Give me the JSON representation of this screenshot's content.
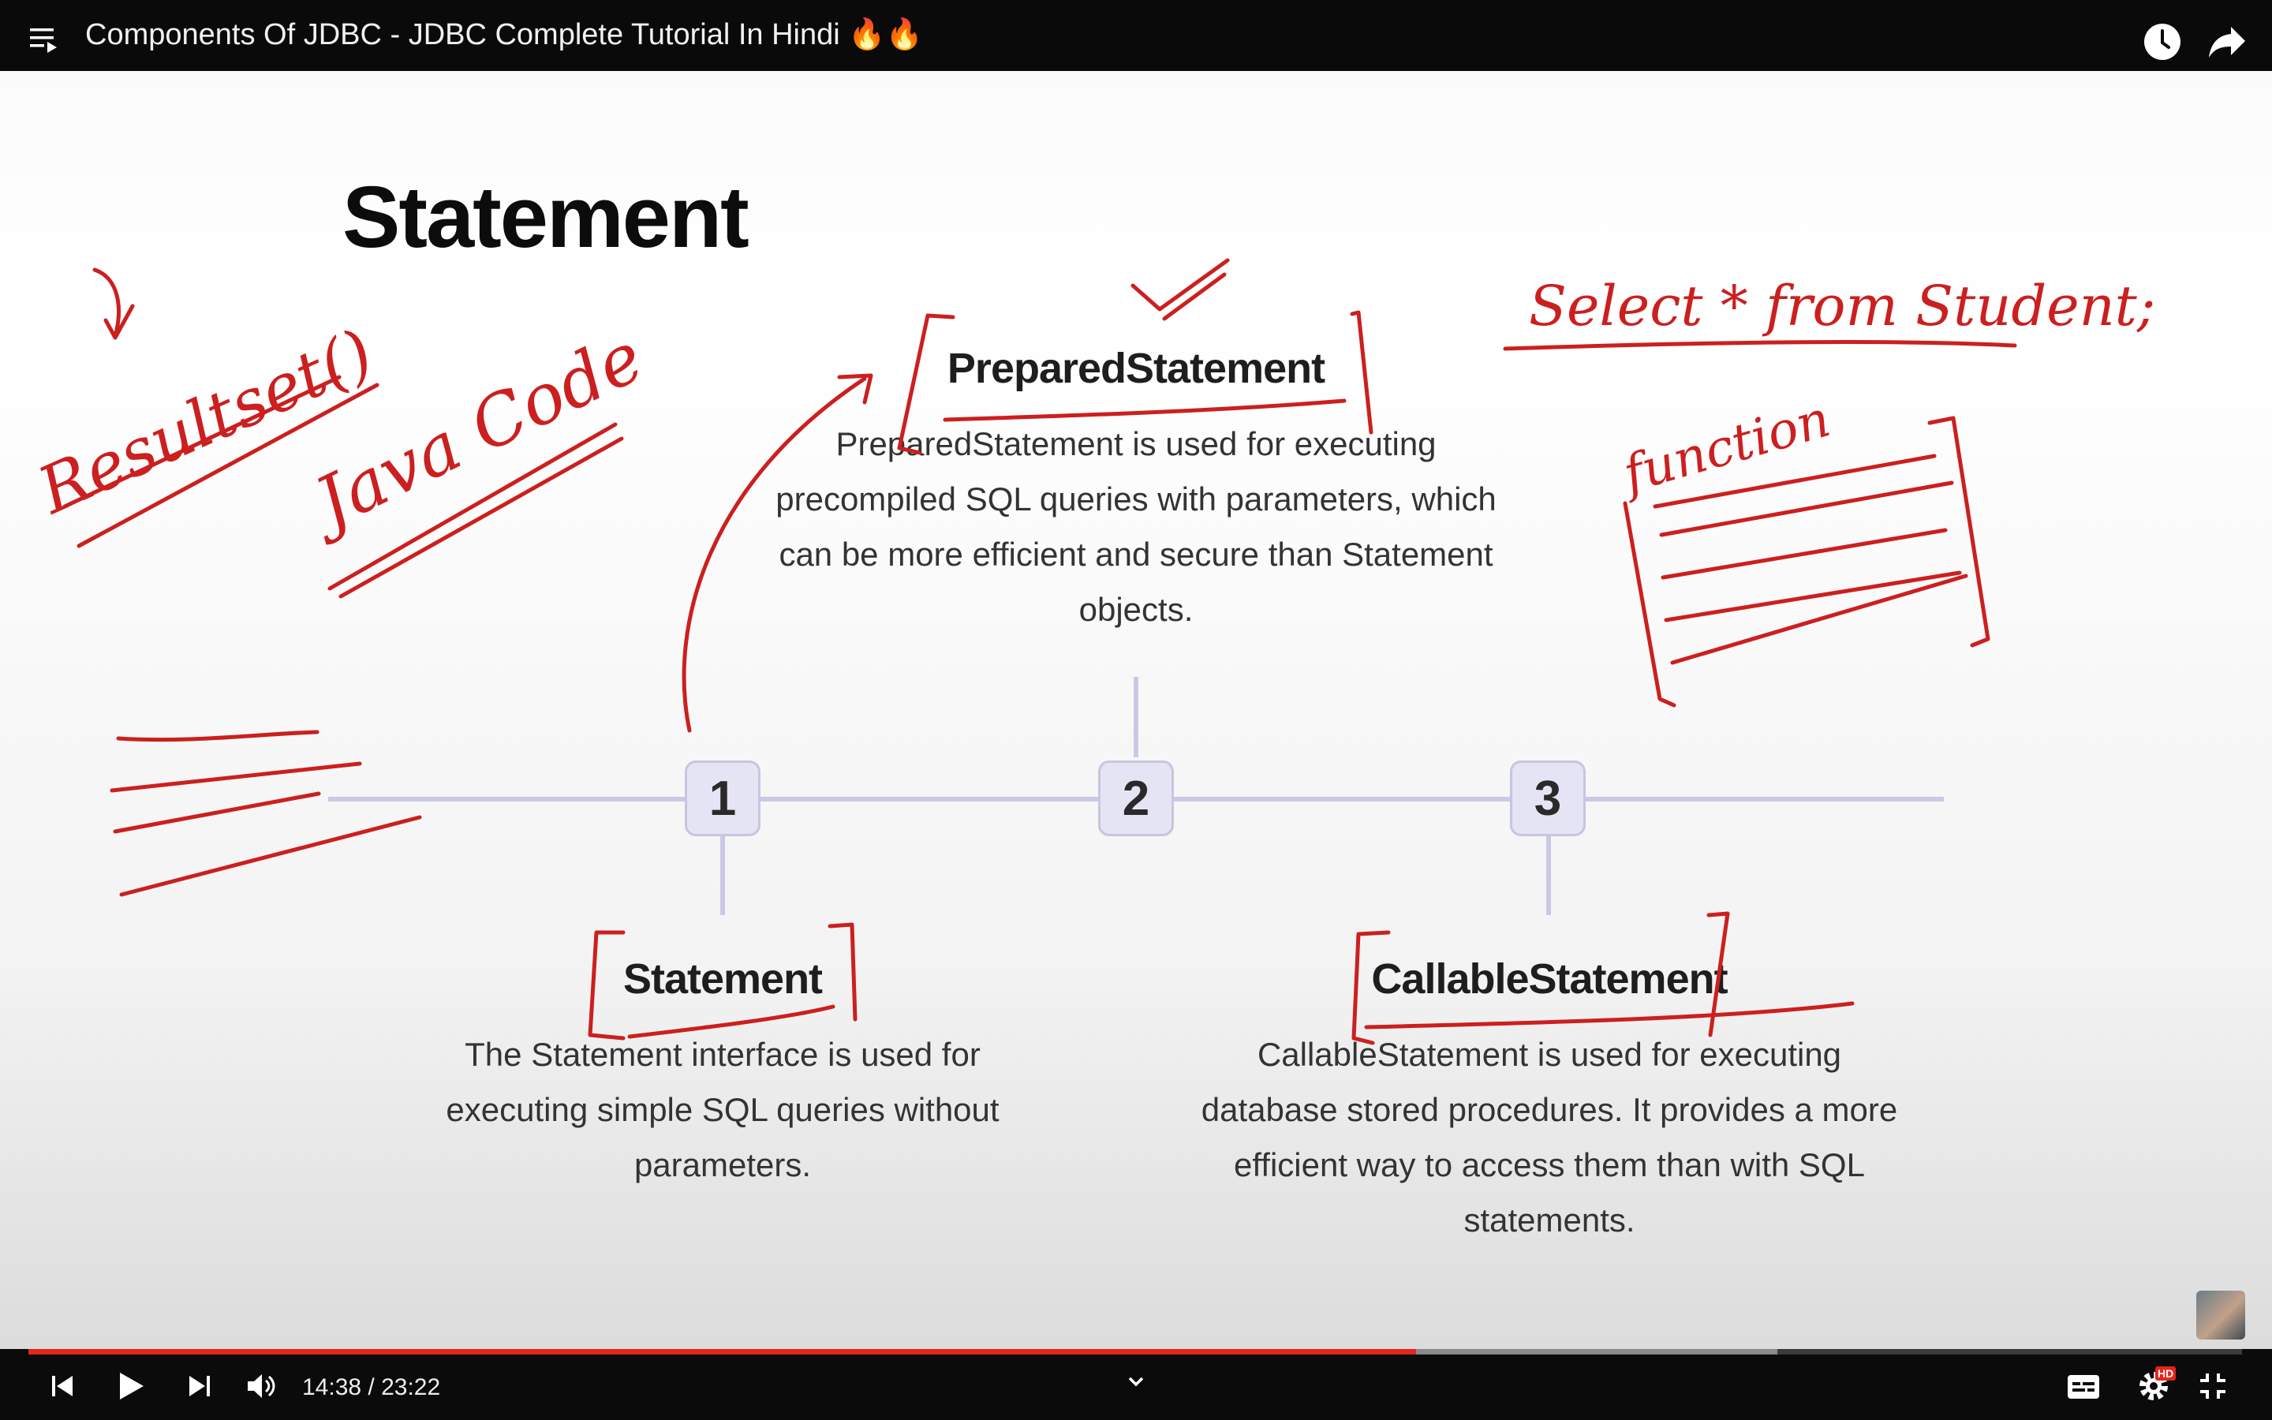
{
  "video": {
    "title": "Components Of JDBC - JDBC Complete Tutorial In Hindi 🔥🔥",
    "current_time": "14:38",
    "duration": "23:22",
    "time_display": "14:38 / 23:22",
    "progress_fraction": 0.627,
    "buffered_fraction": 0.79,
    "accent_color": "#e5241b",
    "hd_badge": "HD"
  },
  "slide": {
    "title": "Statement",
    "nodes": [
      "1",
      "2",
      "3"
    ],
    "items": [
      {
        "heading": "Statement",
        "description": "The Statement interface is used for executing simple SQL queries without parameters."
      },
      {
        "heading": "PreparedStatement",
        "description": "PreparedStatement is used for executing precompiled SQL queries with parameters, which can be more efficient and secure than Statement objects."
      },
      {
        "heading": "CallableStatement",
        "description": "CallableStatement is used for executing database stored procedures. It provides a more efficient way to access them than with SQL statements."
      }
    ],
    "annotations": {
      "resultset": "Resultset()",
      "java_code": "Java Code",
      "sql": "Select * from Student;",
      "function": "function",
      "ink_color": "#cc1f1f"
    }
  },
  "icons": {
    "playlist": "playlist-icon",
    "watch_later": "clock-icon",
    "share": "share-icon",
    "previous": "previous-icon",
    "play": "play-icon",
    "next": "next-icon",
    "volume": "volume-icon",
    "expand": "chevron-down-icon",
    "captions": "captions-icon",
    "settings": "gear-icon",
    "exit_fullscreen": "exit-fullscreen-icon"
  }
}
